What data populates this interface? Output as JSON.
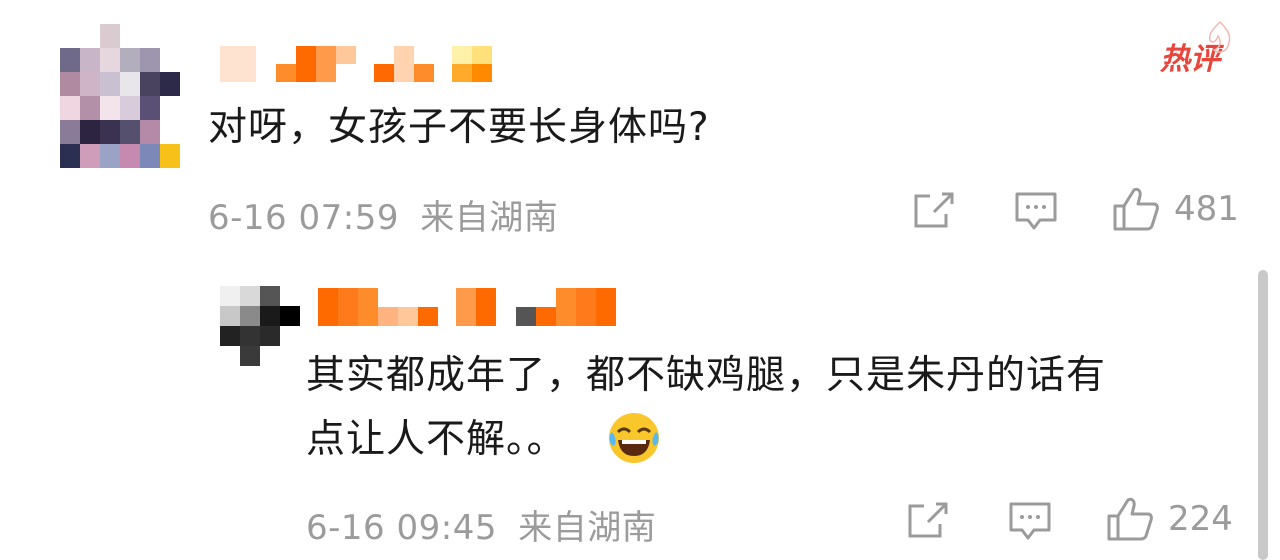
{
  "badge": {
    "label": "热评"
  },
  "comments": [
    {
      "text": "对呀，女孩子不要长身体吗?",
      "date": "6-16 07:59",
      "location": "来自湖南",
      "likes": "481"
    },
    {
      "text_line1": "其实都成年了，都不缺鸡腿，只是朱丹的话有",
      "text_line2": "点让人不解。。",
      "date": "6-16 09:45",
      "location": "来自湖南",
      "likes": "224"
    }
  ],
  "icons": {
    "share": "share-icon",
    "comment": "comment-icon",
    "like": "thumbs-up-icon",
    "emoji": "laughing-crying-emoji-icon"
  },
  "colors": {
    "hot": "#e8453c",
    "meta": "#9b9b9b",
    "name_orange": "#ff6a00"
  }
}
